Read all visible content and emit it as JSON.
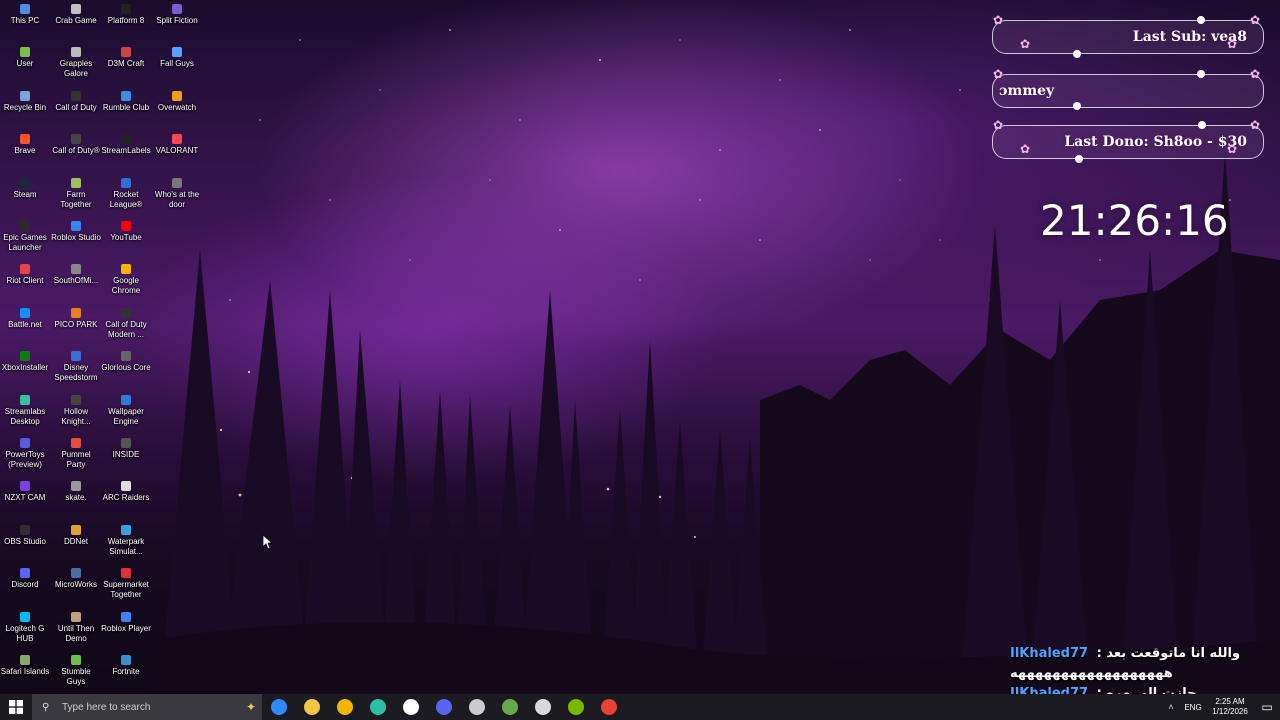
{
  "desktop_icons": [
    {
      "label": "This PC",
      "icon": "this-pc-icon",
      "color": "#4a90e2"
    },
    {
      "label": "Crab Game",
      "icon": "crab-game-icon",
      "color": "#c0c0c0"
    },
    {
      "label": "Platform 8",
      "icon": "platform-8-icon",
      "color": "#222222"
    },
    {
      "label": "Split Fiction",
      "icon": "split-fiction-icon",
      "color": "#7a5cd0"
    },
    {
      "label": "User",
      "icon": "user-folder-icon",
      "color": "#7dbf4a"
    },
    {
      "label": "Grapples Galore",
      "icon": "grapples-galore-icon",
      "color": "#bbbbbb"
    },
    {
      "label": "D3M Craft",
      "icon": "d3m-craft-icon",
      "color": "#c44"
    },
    {
      "label": "Fall Guys",
      "icon": "fall-guys-icon",
      "color": "#5aa0ff"
    },
    {
      "label": "Recycle Bin",
      "icon": "recycle-bin-icon",
      "color": "#7aa6d6"
    },
    {
      "label": "Call of Duty",
      "icon": "call-of-duty-icon",
      "color": "#333"
    },
    {
      "label": "Rumble Club",
      "icon": "rumble-club-icon",
      "color": "#3a8fe0"
    },
    {
      "label": "Overwatch",
      "icon": "overwatch-icon",
      "color": "#f39c12"
    },
    {
      "label": "Brave",
      "icon": "brave-icon",
      "color": "#fb542b"
    },
    {
      "label": "Call of Duty®",
      "icon": "call-of-duty-2-icon",
      "color": "#444"
    },
    {
      "label": "StreamLabels",
      "icon": "streamlabels-icon",
      "color": "#222"
    },
    {
      "label": "VALORANT",
      "icon": "valorant-icon",
      "color": "#ff4655"
    },
    {
      "label": "Steam",
      "icon": "steam-icon",
      "color": "#1b2838"
    },
    {
      "label": "Farm Together",
      "icon": "farm-together-icon",
      "color": "#a0c060"
    },
    {
      "label": "Rocket League®",
      "icon": "rocket-league-icon",
      "color": "#2f6fd1"
    },
    {
      "label": "Who's at the door",
      "icon": "whos-at-the-door-icon",
      "color": "#777"
    },
    {
      "label": "Epic Games Launcher",
      "icon": "epic-games-icon",
      "color": "#2a2a2a"
    },
    {
      "label": "Roblox Studio",
      "icon": "roblox-studio-icon",
      "color": "#3b82f6"
    },
    {
      "label": "YouTube",
      "icon": "youtube-icon",
      "color": "#ff0000"
    },
    {
      "label": "",
      "icon": "",
      "color": ""
    },
    {
      "label": "Riot Client",
      "icon": "riot-client-icon",
      "color": "#e84545"
    },
    {
      "label": "SouthOfMi...",
      "icon": "south-of-midnight-icon",
      "color": "#888"
    },
    {
      "label": "Google Chrome",
      "icon": "chrome-icon",
      "color": "#f4b400"
    },
    {
      "label": "",
      "icon": "",
      "color": ""
    },
    {
      "label": "Battle.net",
      "icon": "battlenet-icon",
      "color": "#148eff"
    },
    {
      "label": "PICO PARK",
      "icon": "pico-park-icon",
      "color": "#e67e22"
    },
    {
      "label": "Call of Duty Modern ...",
      "icon": "cod-modern-icon",
      "color": "#333"
    },
    {
      "label": "",
      "icon": "",
      "color": ""
    },
    {
      "label": "XboxInstaller",
      "icon": "xbox-installer-icon",
      "color": "#107c10"
    },
    {
      "label": "Disney Speedstorm",
      "icon": "disney-speedstorm-icon",
      "color": "#3a6fd8"
    },
    {
      "label": "Glorious Core",
      "icon": "glorious-core-icon",
      "color": "#666"
    },
    {
      "label": "",
      "icon": "",
      "color": ""
    },
    {
      "label": "Streamlabs Desktop",
      "icon": "streamlabs-icon",
      "color": "#31c3a2"
    },
    {
      "label": "Hollow Knight...",
      "icon": "hollow-knight-icon",
      "color": "#444"
    },
    {
      "label": "Wallpaper Engine",
      "icon": "wallpaper-engine-icon",
      "color": "#2a7fd4"
    },
    {
      "label": "",
      "icon": "",
      "color": ""
    },
    {
      "label": "PowerToys (Preview)",
      "icon": "powertoys-icon",
      "color": "#5a5adf"
    },
    {
      "label": "Pummel Party",
      "icon": "pummel-party-icon",
      "color": "#e74c3c"
    },
    {
      "label": "INSIDE",
      "icon": "inside-icon",
      "color": "#555"
    },
    {
      "label": "",
      "icon": "",
      "color": ""
    },
    {
      "label": "NZXT CAM",
      "icon": "nzxt-cam-icon",
      "color": "#7b3fe4"
    },
    {
      "label": "skate.",
      "icon": "skate-icon",
      "color": "#999"
    },
    {
      "label": "ARC Raiders",
      "icon": "arc-raiders-icon",
      "color": "#ddd"
    },
    {
      "label": "",
      "icon": "",
      "color": ""
    },
    {
      "label": "OBS Studio",
      "icon": "obs-studio-icon",
      "color": "#302e31"
    },
    {
      "label": "DDNet",
      "icon": "ddnet-icon",
      "color": "#e0a030"
    },
    {
      "label": "Waterpark Simulat...",
      "icon": "waterpark-simulator-icon",
      "color": "#3aa0e0"
    },
    {
      "label": "",
      "icon": "",
      "color": ""
    },
    {
      "label": "Discord",
      "icon": "discord-icon",
      "color": "#5865f2"
    },
    {
      "label": "MicroWorks",
      "icon": "microworks-icon",
      "color": "#4a6fa5"
    },
    {
      "label": "Supermarket Together",
      "icon": "supermarket-together-icon",
      "color": "#d33"
    },
    {
      "label": "",
      "icon": "",
      "color": ""
    },
    {
      "label": "Logitech G HUB",
      "icon": "logitech-g-hub-icon",
      "color": "#00b8fc"
    },
    {
      "label": "Until Then Demo",
      "icon": "until-then-icon",
      "color": "#c0a080"
    },
    {
      "label": "Roblox Player",
      "icon": "roblox-player-icon",
      "color": "#3b82f6"
    },
    {
      "label": "",
      "icon": "",
      "color": ""
    },
    {
      "label": "Safari Islands",
      "icon": "safari-islands-icon",
      "color": "#8a6"
    },
    {
      "label": "Stumble Guys",
      "icon": "stumble-guys-icon",
      "color": "#6bbf4a"
    },
    {
      "label": "Fortnite",
      "icon": "fortnite-icon",
      "color": "#3a8fd0"
    },
    {
      "label": "",
      "icon": "",
      "color": ""
    }
  ],
  "overlay": {
    "last_sub": "Last Sub: vea8",
    "follower": "ɔmmey",
    "last_dono": "Last Dono: Sh8oo - $30",
    "clock": "21:26:16",
    "accent": "#f3b7e6"
  },
  "chat": [
    {
      "user": "IlKhaled77",
      "sep": " : ",
      "message": "والله انا ماتوقعت بعد"
    },
    {
      "user": "",
      "sep": "",
      "message": "ههههههههههههههههههه"
    },
    {
      "user": "IlKhaled77",
      "sep": " : ",
      "message": "جازت الي مره"
    }
  ],
  "taskbar": {
    "search_placeholder": "Type here to search",
    "apps": [
      {
        "icon": "microsoft-store-icon",
        "color": "#2e8bff"
      },
      {
        "icon": "file-explorer-icon",
        "color": "#f4c542"
      },
      {
        "icon": "chrome-icon",
        "color": "#f4b400"
      },
      {
        "icon": "edge-icon",
        "color": "#2ebfa5"
      },
      {
        "icon": "steam-icon",
        "color": "#ffffff"
      },
      {
        "icon": "discord-icon",
        "color": "#5865f2"
      },
      {
        "icon": "obs-studio-icon",
        "color": "#cccccc"
      },
      {
        "icon": "minecraft-icon",
        "color": "#6aa84f"
      },
      {
        "icon": "cube-app-icon",
        "color": "#d9d9d9"
      },
      {
        "icon": "nvidia-icon",
        "color": "#76b900"
      },
      {
        "icon": "chrome-profile-icon",
        "color": "#e94335"
      }
    ],
    "lang": "ENG",
    "time": "2:25 AM",
    "date": "1/12/2026"
  }
}
